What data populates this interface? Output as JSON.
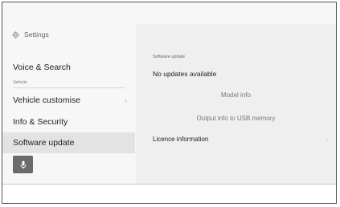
{
  "sidebar": {
    "header": "Settings",
    "items": [
      {
        "label": "Voice & Search"
      },
      {
        "label": "Vehicle customise",
        "chevron": "›"
      },
      {
        "label": "Info & Security"
      },
      {
        "label": "Software update"
      }
    ],
    "group_label": "Vehicle",
    "active_item": "Software update",
    "mic_button_icon": "microphone-icon"
  },
  "content": {
    "section_title": "Software update",
    "status": "No updates available",
    "buttons": {
      "model_info": "Model info",
      "output_usb": "Output info to USB memory"
    },
    "licence_row": {
      "label": "Licence information",
      "chevron": "›"
    }
  },
  "colors": {
    "active_bg": "#e3e3e3",
    "mic_button": "#6a6a6a",
    "disabled_text": "#777777"
  }
}
